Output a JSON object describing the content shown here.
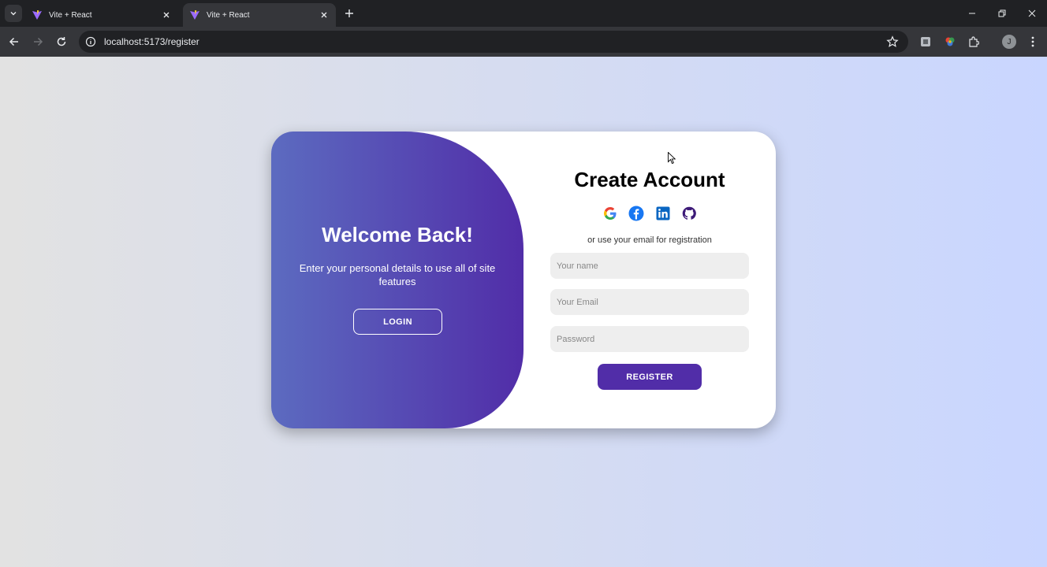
{
  "browser": {
    "tabs": [
      {
        "title": "Vite + React",
        "active": false
      },
      {
        "title": "Vite + React",
        "active": true
      }
    ],
    "url": "localhost:5173/register",
    "profile_initial": "J",
    "icons": {
      "favicon": "vite-logo-icon",
      "back": "arrow-left-icon",
      "forward": "arrow-right-icon",
      "reload": "reload-icon",
      "bookmark": "star-icon",
      "menu": "kebab-menu-icon"
    }
  },
  "page": {
    "background_colors": [
      "#e2e2e2",
      "#c9d6ff"
    ],
    "toggle_panel": {
      "title": "Welcome Back!",
      "text": "Enter your personal details to use all of site features",
      "button_label": "LOGIN",
      "colors": [
        "#5c6bc0",
        "#512da8"
      ]
    },
    "form": {
      "title": "Create Account",
      "social_icons": [
        "google-icon",
        "facebook-icon",
        "linkedin-icon",
        "github-icon"
      ],
      "caption": "or use your email for registration",
      "fields": {
        "name_placeholder": "Your name",
        "email_placeholder": "Your Email",
        "password_placeholder": "Password"
      },
      "submit_label": "REGISTER",
      "accent": "#512da8"
    }
  }
}
